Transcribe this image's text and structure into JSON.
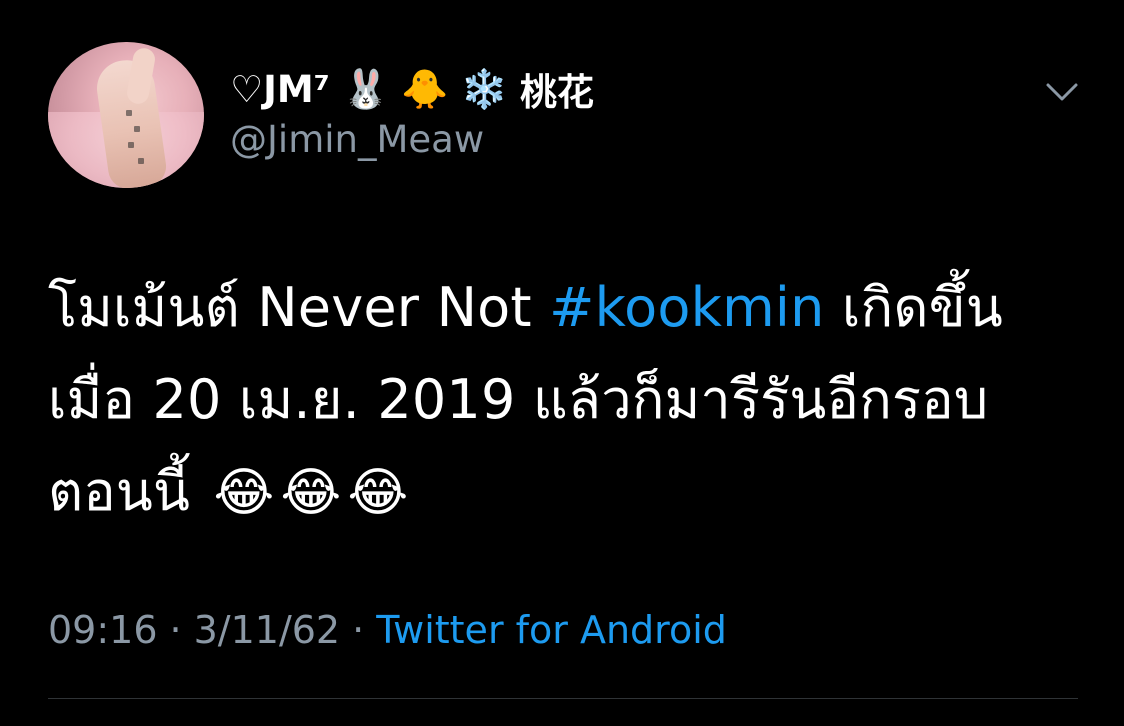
{
  "author": {
    "display_name": "♡JM⁷",
    "name_emojis": [
      "🐰",
      "🐥",
      "❄️"
    ],
    "name_suffix": "桃花",
    "handle": "@Jimin_Meaw"
  },
  "tweet": {
    "line1_pre": "โมเม้นต์ Never Not ",
    "hashtag": "#kookmin",
    "line1_post": " เกิดขึ้น",
    "line2": "เมื่อ 20 เม.ย. 2019 แล้วก็มารีรันอีกรอบ",
    "line3": "ตอนนี้",
    "emojis": [
      "😂",
      "😂",
      "😂"
    ]
  },
  "meta": {
    "time": "09:16",
    "date": "3/11/62",
    "separator": "·",
    "source": "Twitter for Android"
  },
  "colors": {
    "background": "#000000",
    "text": "#ffffff",
    "secondary": "#8b98a5",
    "link": "#1d9bf0"
  },
  "icons": {
    "menu": "chevron-down-icon"
  }
}
